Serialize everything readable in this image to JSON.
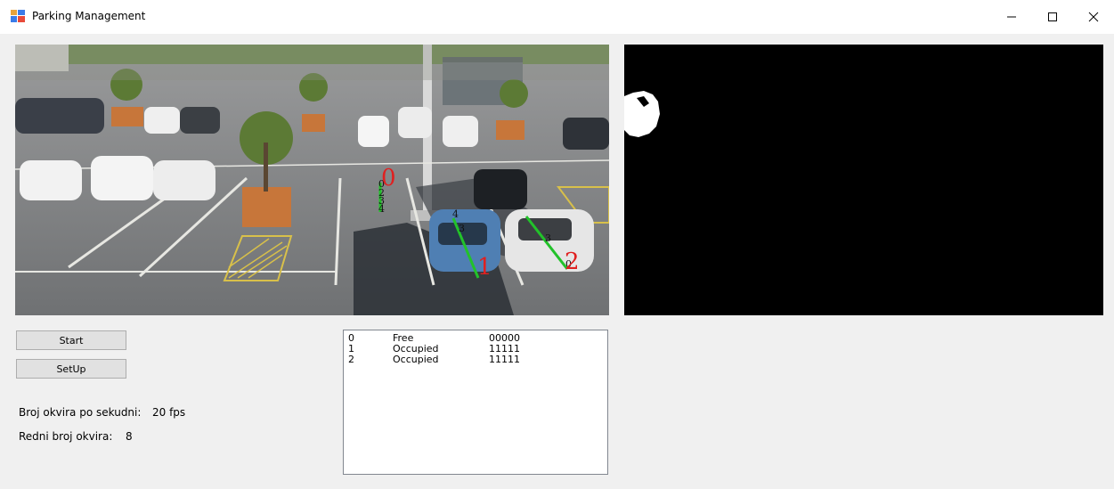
{
  "window": {
    "title": "Parking Management",
    "controls": [
      "minimize-icon",
      "maximize-icon",
      "close-icon"
    ]
  },
  "buttons": {
    "start": "Start",
    "setup": "SetUp"
  },
  "stats": {
    "fps_label": "Broj okvira po sekudni:",
    "fps_value": "20 fps",
    "frame_label": "Redni broj okvira:",
    "frame_value": "8"
  },
  "parking_list": [
    {
      "id": "0",
      "status": "Free",
      "code": "00000"
    },
    {
      "id": "1",
      "status": "Occupied",
      "code": "11111"
    },
    {
      "id": "2",
      "status": "Occupied",
      "code": "11111"
    }
  ],
  "overlay": {
    "spot_labels": [
      "0",
      "1",
      "2"
    ],
    "line_color": "#22c22a",
    "label_color": "#e02020"
  }
}
